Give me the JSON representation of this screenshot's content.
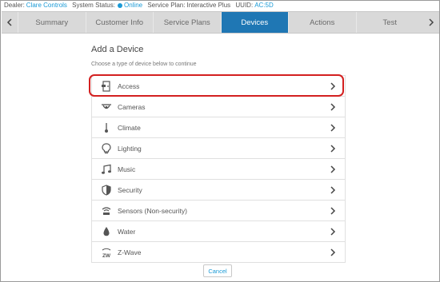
{
  "status_bar": {
    "dealer_label": "Dealer:",
    "dealer_value": "Clare Controls",
    "system_status_label": "System Status:",
    "system_status_value": "Online",
    "service_plan_label": "Service Plan:",
    "service_plan_value": "Interactive Plus",
    "uuid_label": "UUID:",
    "uuid_value": "AC:5D"
  },
  "tabs": [
    {
      "label": "Summary"
    },
    {
      "label": "Customer Info"
    },
    {
      "label": "Service Plans"
    },
    {
      "label": "Devices",
      "active": true
    },
    {
      "label": "Actions"
    },
    {
      "label": "Test"
    }
  ],
  "nav": {
    "prev_icon": "chevron-left-icon",
    "next_icon": "chevron-right-icon"
  },
  "panel": {
    "title": "Add a Device",
    "subtitle": "Choose a type of device below to continue"
  },
  "devices": [
    {
      "label": "Access",
      "icon": "door-lock-icon",
      "highlighted": true
    },
    {
      "label": "Cameras",
      "icon": "camera-icon"
    },
    {
      "label": "Climate",
      "icon": "thermometer-icon"
    },
    {
      "label": "Lighting",
      "icon": "lightbulb-icon"
    },
    {
      "label": "Music",
      "icon": "music-note-icon"
    },
    {
      "label": "Security",
      "icon": "shield-icon"
    },
    {
      "label": "Sensors (Non-security)",
      "icon": "sensor-icon"
    },
    {
      "label": "Water",
      "icon": "water-drop-icon"
    },
    {
      "label": "Z-Wave",
      "icon": "zwave-icon",
      "icon_text": "ZW"
    }
  ],
  "cancel_label": "Cancel",
  "colors": {
    "accent": "#1f77b4",
    "link": "#1a9ad6",
    "highlight": "#d32020"
  }
}
